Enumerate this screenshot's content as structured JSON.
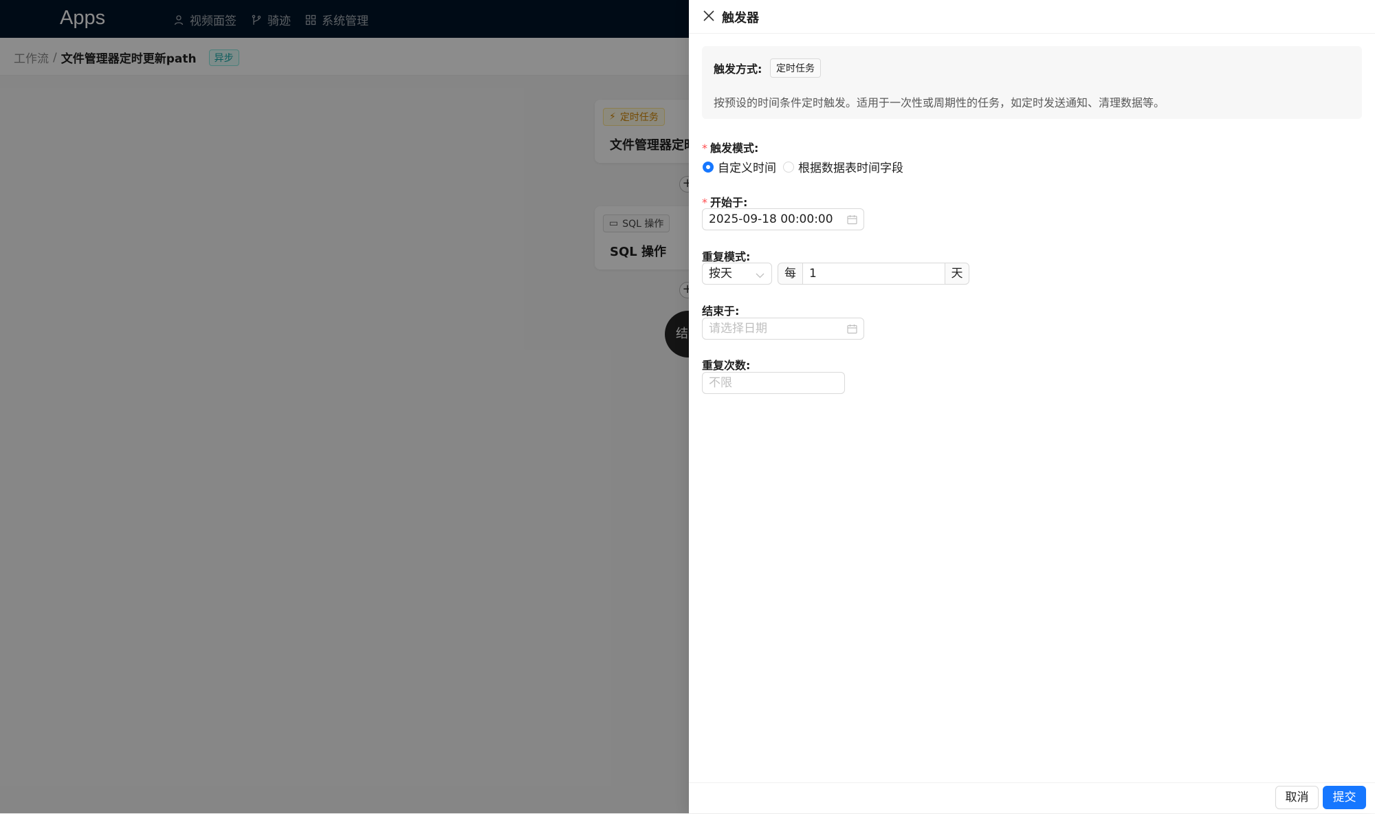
{
  "app": {
    "logo": "Apps"
  },
  "nav": [
    {
      "label": "视频面签",
      "icon": "user-icon"
    },
    {
      "label": "骑迹",
      "icon": "branch-icon"
    },
    {
      "label": "系统管理",
      "icon": "grid-icon"
    }
  ],
  "breadcrumb": {
    "root": "工作流",
    "separator": "/",
    "current": "文件管理器定时更新path",
    "badge": "异步"
  },
  "canvas": {
    "node1": {
      "tag": "定时任务",
      "title": "文件管理器定时"
    },
    "node2": {
      "tag": "SQL 操作",
      "title": "SQL 操作"
    },
    "plus": "+",
    "end": "结"
  },
  "drawer": {
    "title": "触发器",
    "info": {
      "label": "触发方式:",
      "tag": "定时任务",
      "description": "按预设的时间条件定时触发。适用于一次性或周期性的任务，如定时发送通知、清理数据等。"
    },
    "fields": {
      "trigger_mode": {
        "label": "触发模式:",
        "options": [
          "自定义时间",
          "根据数据表时间字段"
        ],
        "selected": "自定义时间"
      },
      "start": {
        "label": "开始于:",
        "value": "2025-09-18 00:00:00"
      },
      "repeat": {
        "label": "重复模式:",
        "select_value": "按天",
        "prefix": "每",
        "value": "1",
        "suffix": "天"
      },
      "end": {
        "label": "结束于:",
        "placeholder": "请选择日期"
      },
      "repeat_count": {
        "label": "重复次数:",
        "placeholder": "不限"
      }
    },
    "footer": {
      "cancel": "取消",
      "submit": "提交"
    }
  },
  "colors": {
    "primary": "#1677ff",
    "nav_bg": "#001529",
    "required": "#ff4d4f"
  }
}
